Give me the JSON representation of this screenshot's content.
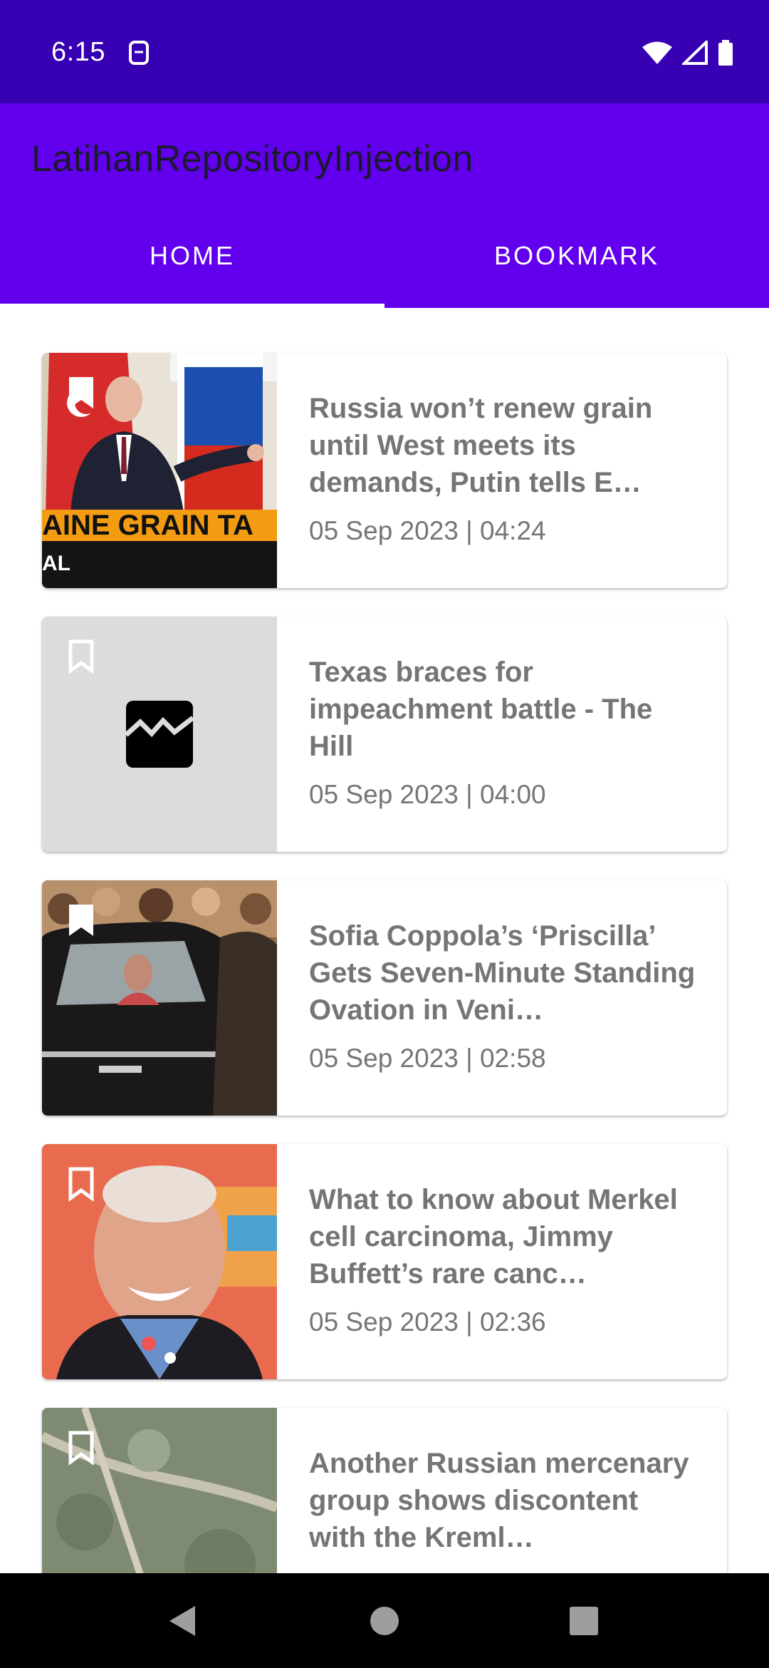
{
  "status_bar": {
    "time": "6:15",
    "icons": [
      "sim-card-icon",
      "wifi-icon",
      "signal-icon",
      "battery-icon"
    ]
  },
  "app_bar": {
    "title": "LatihanRepositoryInjection",
    "color": "#6200EE",
    "status_color": "#3700B3"
  },
  "tabs": [
    {
      "label": "HOME",
      "selected": true
    },
    {
      "label": "BOOKMARK",
      "selected": false
    }
  ],
  "news": [
    {
      "title": "Russia won’t renew grain until West meets its demands, Putin tells E…",
      "date": "05 Sep 2023 | 04:24",
      "bookmarked": true,
      "thumb": "putin-photo",
      "thumb_text": [
        "AINE GRAIN TA",
        "AL"
      ]
    },
    {
      "title": "Texas braces for impeachment battle - The Hill",
      "date": "05 Sep 2023 | 04:00",
      "bookmarked": false,
      "thumb": "broken-image-icon"
    },
    {
      "title": "Sofia Coppola’s ‘Priscilla’ Gets Seven-Minute Standing Ovation in Veni…",
      "date": "05 Sep 2023 | 02:58",
      "bookmarked": true,
      "thumb": "priscilla-photo"
    },
    {
      "title": "What to know about Merkel cell carcinoma, Jimmy Buffett’s rare canc…",
      "date": "05 Sep 2023 | 02:36",
      "bookmarked": false,
      "thumb": "buffett-photo"
    },
    {
      "title": "Another Russian mercenary group shows discontent with the Kreml…",
      "date": "",
      "bookmarked": false,
      "thumb": "aerial-photo"
    }
  ],
  "nav": [
    "back-icon",
    "home-icon",
    "recents-icon"
  ]
}
